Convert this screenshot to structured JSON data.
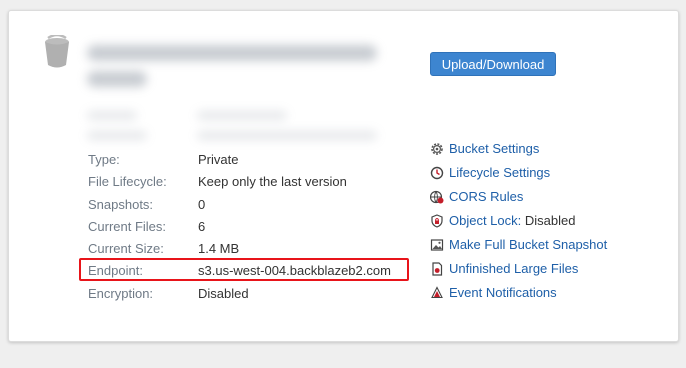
{
  "bucket": {
    "details": [
      {
        "label": "Type:",
        "value": "Private"
      },
      {
        "label": "File Lifecycle:",
        "value": "Keep only the last version"
      },
      {
        "label": "Snapshots:",
        "value": "0"
      },
      {
        "label": "Current Files:",
        "value": "6"
      },
      {
        "label": "Current Size:",
        "value": "1.4 MB"
      },
      {
        "label": "Endpoint:",
        "value": "s3.us-west-004.backblazeb2.com"
      },
      {
        "label": "Encryption:",
        "value": "Disabled"
      }
    ]
  },
  "actions": {
    "upload_download_label": "Upload/Download",
    "links": [
      {
        "label": "Bucket Settings",
        "icon": "gear-icon"
      },
      {
        "label": "Lifecycle Settings",
        "icon": "clock-icon"
      },
      {
        "label": "CORS Rules",
        "icon": "cors-icon"
      },
      {
        "label": "Object Lock:",
        "suffix": " Disabled",
        "icon": "lock-shield-icon"
      },
      {
        "label": "Make Full Bucket Snapshot",
        "icon": "image-icon"
      },
      {
        "label": "Unfinished Large Files",
        "icon": "file-icon"
      },
      {
        "label": "Event Notifications",
        "icon": "bell-icon"
      }
    ]
  },
  "colors": {
    "accent": "#3d85d0",
    "link": "#1e5fa8",
    "highlight": "#e8141a"
  }
}
